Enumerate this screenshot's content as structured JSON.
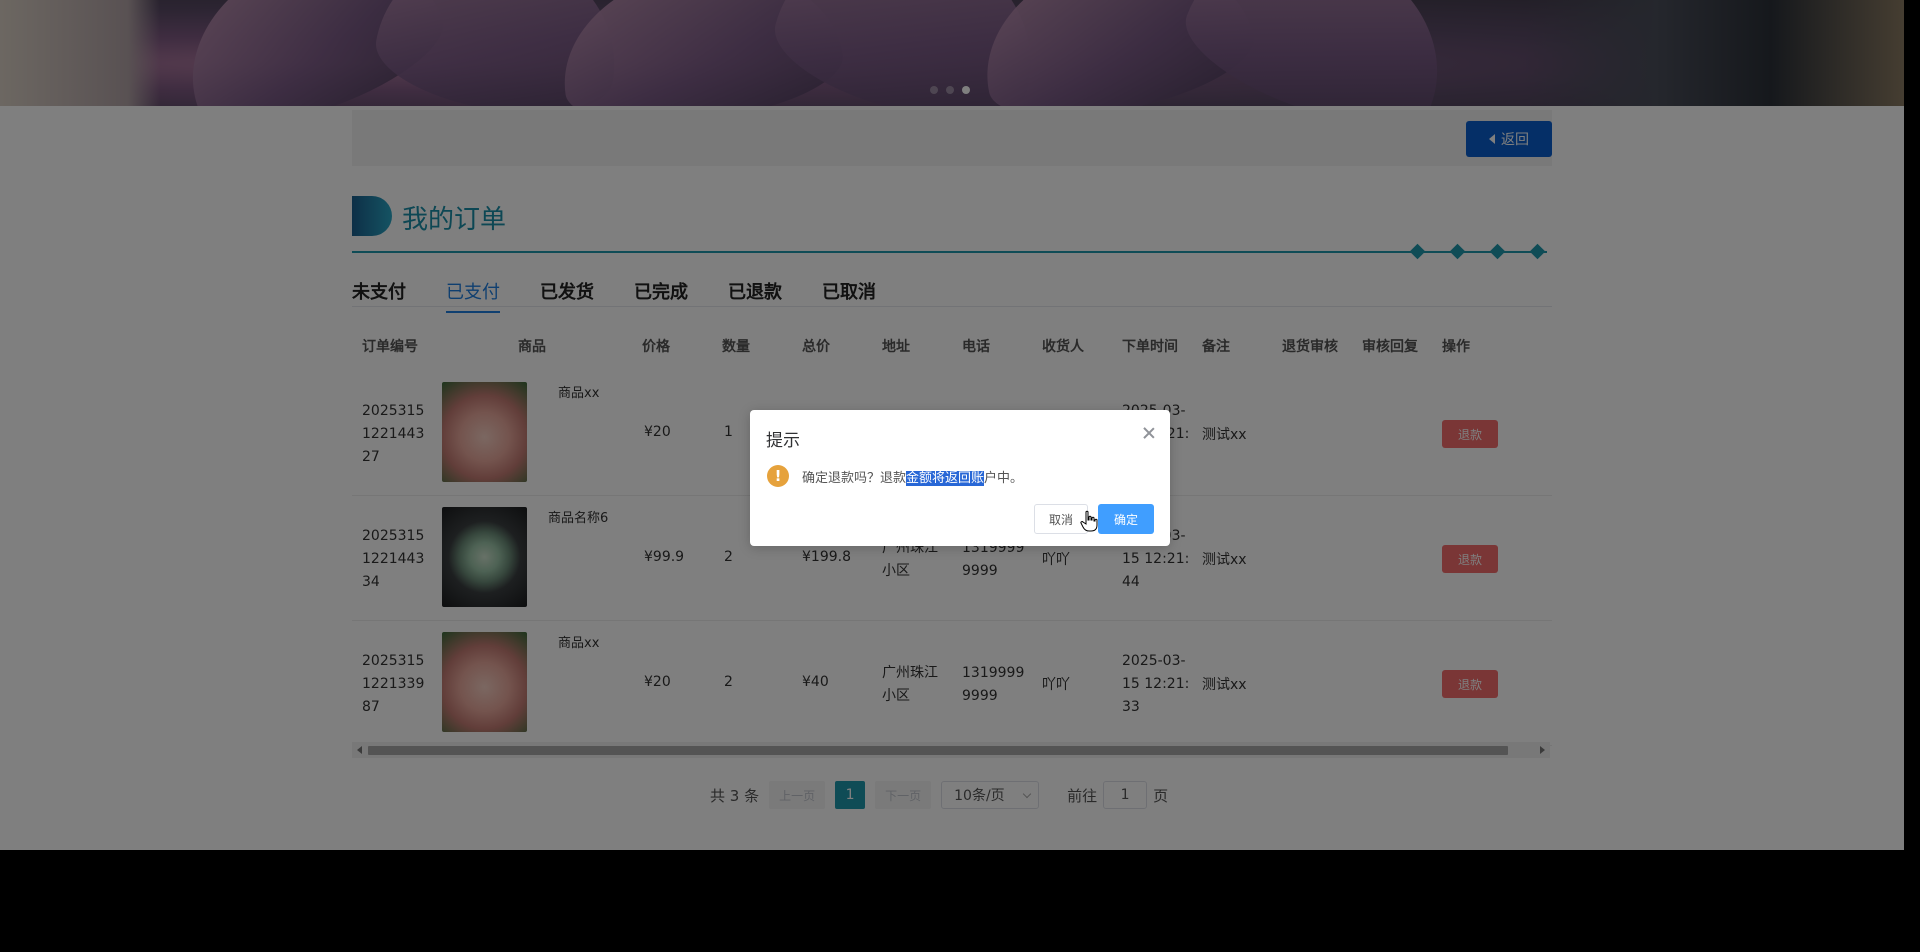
{
  "header": {
    "back_label": "返回"
  },
  "page_title": "我的订单",
  "tabs": [
    {
      "label": "未支付",
      "active": false
    },
    {
      "label": "已支付",
      "active": true
    },
    {
      "label": "已发货",
      "active": false
    },
    {
      "label": "已完成",
      "active": false
    },
    {
      "label": "已退款",
      "active": false
    },
    {
      "label": "已取消",
      "active": false
    }
  ],
  "table": {
    "columns": [
      "订单编号",
      "商品",
      "价格",
      "数量",
      "总价",
      "地址",
      "电话",
      "收货人",
      "下单时间",
      "备注",
      "退货审核",
      "审核回复",
      "操作"
    ],
    "rows": [
      {
        "order_no_1": "2025315",
        "order_no_2": "1221443",
        "order_no_3": "27",
        "image": "pink-succulent",
        "product": "商品xx",
        "price": "¥20",
        "qty": "1",
        "total": "",
        "addr_1": "",
        "addr_2": "",
        "phone_1": "",
        "phone_2": "",
        "receiver": "",
        "time_1": "2025-03-",
        "time_2": "15 12:21:",
        "time_3": "",
        "note": "测试xx",
        "action": "退款"
      },
      {
        "order_no_1": "2025315",
        "order_no_2": "1221443",
        "order_no_3": "34",
        "image": "green-succulent",
        "product": "商品名称6",
        "price": "¥99.9",
        "qty": "2",
        "total": "¥199.8",
        "addr_1": "广州珠江",
        "addr_2": "小区",
        "phone_1": "1319999",
        "phone_2": "9999",
        "receiver": "吖吖",
        "time_1": "2025-03-",
        "time_2": "15 12:21:",
        "time_3": "44",
        "note": "测试xx",
        "action": "退款"
      },
      {
        "order_no_1": "2025315",
        "order_no_2": "1221339",
        "order_no_3": "87",
        "image": "pink-succulent",
        "product": "商品xx",
        "price": "¥20",
        "qty": "2",
        "total": "¥40",
        "addr_1": "广州珠江",
        "addr_2": "小区",
        "phone_1": "1319999",
        "phone_2": "9999",
        "receiver": "吖吖",
        "time_1": "2025-03-",
        "time_2": "15 12:21:",
        "time_3": "33",
        "note": "测试xx",
        "action": "退款"
      }
    ]
  },
  "pagination": {
    "total_text": "共 3 条",
    "prev": "上一页",
    "current": "1",
    "next": "下一页",
    "page_size": "10条/页",
    "goto_prefix": "前往",
    "goto_value": "1",
    "goto_suffix": "页"
  },
  "dialog": {
    "title": "提示",
    "icon": "warning-icon",
    "message_before": "确定退款吗？退款",
    "message_highlight": "金额将返回账",
    "message_after": "户中。",
    "cancel": "取消",
    "confirm": "确定"
  },
  "colors": {
    "accent": "#1f98ac",
    "primary": "#0a5fcf",
    "danger": "#f56c6c",
    "confirm": "#409eff",
    "warning": "#e6a23c"
  }
}
